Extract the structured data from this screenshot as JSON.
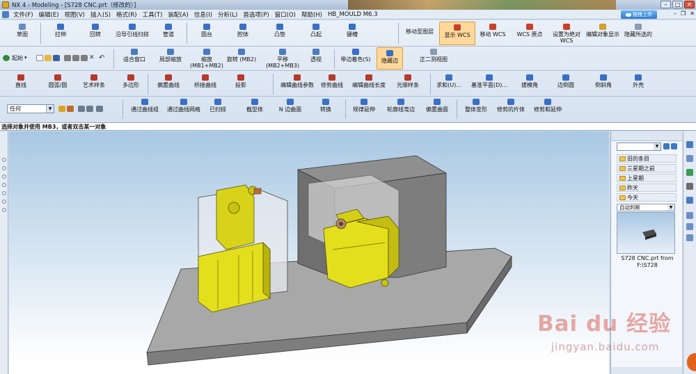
{
  "window": {
    "title": "NX 4 - Modeling - [S728 CNC.prt（修改的）]",
    "upload_label": "拖拽上传"
  },
  "menu": {
    "items": [
      "文件(F)",
      "编辑(E)",
      "视图(V)",
      "插入(S)",
      "格式(R)",
      "工具(T)",
      "装配(A)",
      "信息(I)",
      "分析(L)",
      "首选项(P)",
      "窗口(O)",
      "帮助(H)",
      "HB_MOULD M6.3"
    ]
  },
  "toolbar": {
    "row1": [
      "草图",
      "拉伸",
      "回转",
      "沿导引线扫掠",
      "管道",
      "圆台",
      "腔体",
      "凸垫",
      "凸起",
      "键槽",
      "移动至图层",
      "显示 WCS",
      "移动 WCS",
      "WCS 原点",
      "设置为绝对",
      "WCS",
      "编辑对象显示",
      "隐藏所选的"
    ],
    "row2": [
      "起始",
      "适合窗口",
      "局部缩放",
      "缩放",
      "(MB1+MB2)",
      "旋转 (MB2)",
      "平移",
      "(MB2+MB3)",
      "透视",
      "带边着色(S)",
      "隐藏边",
      "正二测视图"
    ],
    "row3": [
      "直线",
      "圆弧/圆",
      "艺术样条",
      "多边形",
      "偏置曲线",
      "桥接曲线",
      "投影",
      "编辑曲线参数",
      "修剪曲线",
      "编辑曲线长度",
      "光顺样条",
      "求和(U)...",
      "基准平面(D)...",
      "拔模角",
      "边倒圆",
      "倒斜角",
      "外壳"
    ],
    "row4_filter": "任何",
    "row4": [
      "通过曲线组",
      "通过曲线网格",
      "已扫掠",
      "截型体",
      "N 边曲面",
      "转换",
      "规律延伸",
      "轮廓线弯边",
      "偏置曲面",
      "整体变形",
      "修剪的片体",
      "修剪和延伸"
    ]
  },
  "status": {
    "prompt": "选择对象并使用 MB3，或者双击某一对象"
  },
  "history_panel": {
    "groups": [
      "旧的条目",
      "三星期之前",
      "上星期",
      "昨天",
      "今天"
    ],
    "filter": "自动判断",
    "recent_file": "S728 CNC.prt from F:\\S728"
  },
  "watermark": {
    "text": "Bai du 经验",
    "url": "jingyan.baidu.com"
  },
  "colors": {
    "active_tool": "#ffd89b",
    "part_yellow": "#e3df1c",
    "base_plate": "#9a9a9a"
  }
}
